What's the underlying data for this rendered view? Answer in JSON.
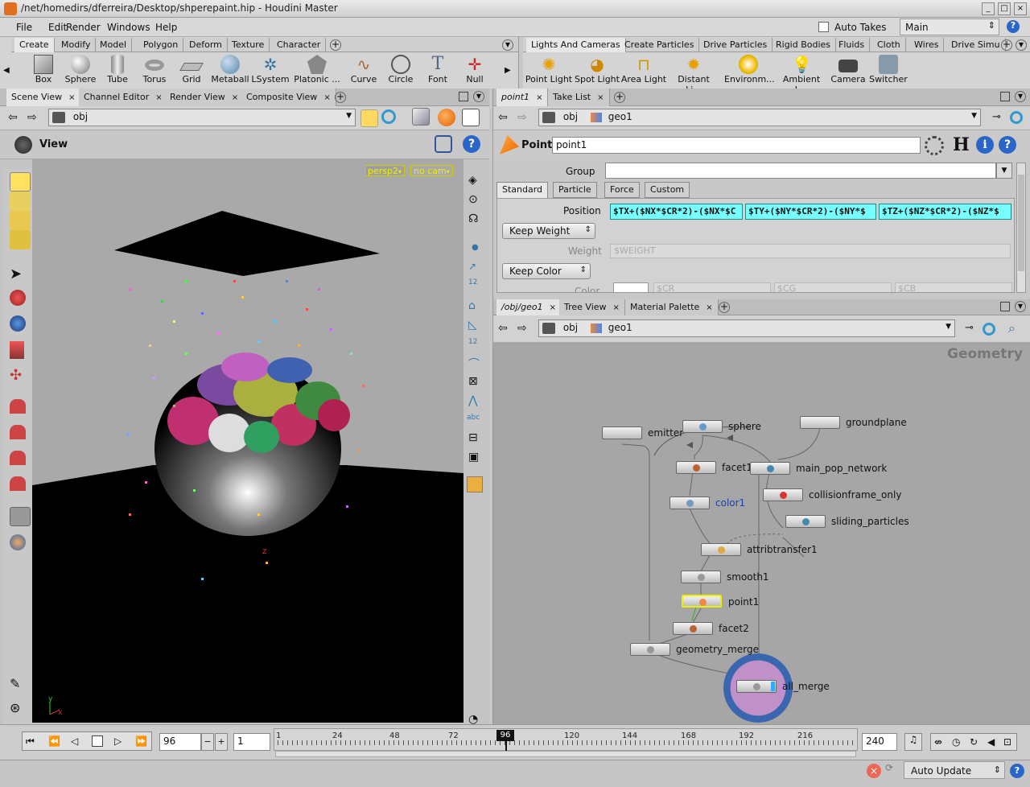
{
  "window": {
    "title": "/net/homedirs/dferreira/Desktop/shperepaint.hip - Houdini Master"
  },
  "menu": [
    "File",
    "Edit",
    "Render",
    "Windows",
    "Help"
  ],
  "auto_takes": "Auto Takes",
  "desktop": "Main",
  "shelf_left": {
    "tabs": [
      "Create",
      "Modify",
      "Model",
      "Polygon",
      "Deform",
      "Texture",
      "Character"
    ],
    "tools": [
      "Box",
      "Sphere",
      "Tube",
      "Torus",
      "Grid",
      "Metaball",
      "LSystem",
      "Platonic ...",
      "Curve",
      "Circle",
      "Font",
      "Null"
    ]
  },
  "shelf_right": {
    "tabs": [
      "Lights And Cameras",
      "Create Particles",
      "Drive Particles",
      "Rigid Bodies",
      "Fluids",
      "Cloth",
      "Wires",
      "Drive Simu"
    ],
    "tools": [
      "Point Light",
      "Spot Light",
      "Area Light",
      "Distant Li...",
      "Environm...",
      "Ambient L...",
      "Camera",
      "Switcher"
    ]
  },
  "viewer": {
    "tabs": [
      "Scene View",
      "Channel Editor",
      "Render View",
      "Composite View"
    ],
    "path": "obj",
    "title": "View",
    "cam": "persp2",
    "nocam": "no cam",
    "axis_y": "y",
    "axis_x": "x",
    "axis_z": "z"
  },
  "params": {
    "tabs": [
      "point1",
      "Take List"
    ],
    "path1": "obj",
    "path2": "geo1",
    "op_type": "Point",
    "op_name": "point1",
    "group_label": "Group",
    "subtabs": [
      "Standard",
      "Particle",
      "Force",
      "Custom"
    ],
    "position_label": "Position",
    "pos_x": "$TX+($NX*$CR*2)-($NX*$C",
    "pos_y": "$TY+($NY*$CR*2)-($NY*$",
    "pos_z": "$TZ+($NZ*$CR*2)-($NZ*$",
    "keep_weight": "Keep Weight",
    "weight_label": "Weight",
    "weight_value": "$WEIGHT",
    "keep_color": "Keep Color",
    "color_label": "Color",
    "cr": "$CR",
    "cg": "$CG",
    "cb": "$CB"
  },
  "network": {
    "tabs": [
      "/obj/geo1",
      "Tree View",
      "Material Palette"
    ],
    "path1": "obj",
    "path2": "geo1",
    "context": "Geometry",
    "nodes": [
      "emitter",
      "sphere",
      "groundplane",
      "facet1",
      "main_pop_network",
      "collisionframe_only",
      "color1",
      "sliding_particles",
      "attribtransfer1",
      "smooth1",
      "point1",
      "facet2",
      "geometry_merge",
      "all_merge"
    ]
  },
  "timeline": {
    "frame": "96",
    "step": "1",
    "end": "240",
    "ticks": [
      "1",
      "24",
      "48",
      "72",
      "96",
      "120",
      "144",
      "168",
      "192",
      "216"
    ],
    "current": "96"
  },
  "status": {
    "update": "Auto Update"
  }
}
